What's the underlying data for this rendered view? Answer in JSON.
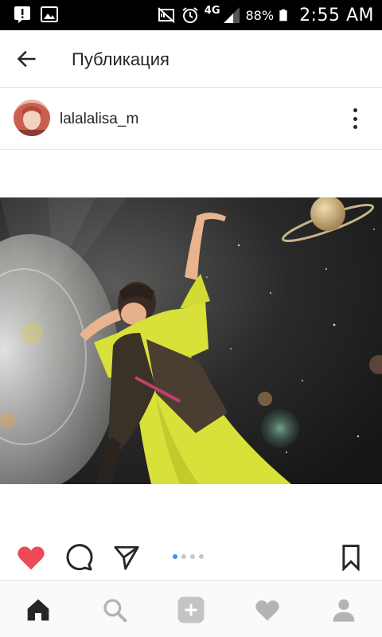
{
  "status_bar": {
    "network": "4G",
    "battery": "88%",
    "time": "2:55 AM",
    "icons": [
      "notification-alert-icon",
      "gallery-icon",
      "mute-icon",
      "alarm-icon",
      "signal-icon",
      "battery-icon"
    ]
  },
  "app_bar": {
    "title": "Публикация",
    "back_icon": "arrow-left-icon"
  },
  "post": {
    "username": "lalalalisa_m",
    "avatar_icon": "avatar",
    "more_icon": "more-vertical-icon",
    "liked": true,
    "carousel": {
      "count": 4,
      "active_index": 0
    }
  },
  "actions": {
    "icons": [
      "heart-icon",
      "comment-icon",
      "share-icon",
      "bookmark-icon"
    ]
  },
  "bottom_nav": {
    "items": [
      "home-icon",
      "search-icon",
      "add-icon",
      "activity-icon",
      "profile-icon"
    ],
    "active": "home-icon"
  },
  "colors": {
    "like_red": "#ed4956",
    "carousel_active": "#3897f0",
    "status_bar_bg": "#000000",
    "text": "#262626"
  }
}
